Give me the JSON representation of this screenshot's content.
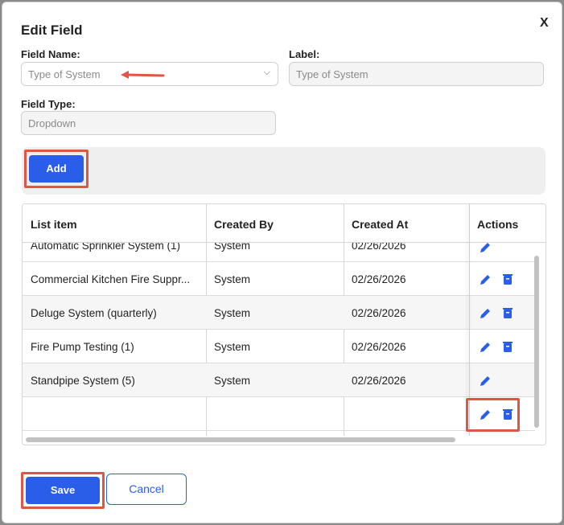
{
  "dialog": {
    "title": "Edit Field",
    "close_label": "X"
  },
  "form": {
    "field_name_label": "Field Name:",
    "field_name_value": "Type of System",
    "label_label": "Label:",
    "label_value": "Type of System",
    "field_type_label": "Field Type:",
    "field_type_value": "Dropdown"
  },
  "add_button_label": "Add",
  "table": {
    "headers": [
      "List item",
      "Created By",
      "Created At",
      "Actions"
    ],
    "rows": [
      {
        "item": "Automatic Sprinkler System (1)",
        "created_by": "System",
        "created_at": "02/26/2026",
        "actions": [
          "edit"
        ]
      },
      {
        "item": "Commercial Kitchen Fire Suppr...",
        "created_by": "System",
        "created_at": "02/26/2026",
        "actions": [
          "edit",
          "delete"
        ]
      },
      {
        "item": "Deluge System (quarterly)",
        "created_by": "System",
        "created_at": "02/26/2026",
        "actions": [
          "edit",
          "delete"
        ]
      },
      {
        "item": "Fire Pump Testing (1)",
        "created_by": "System",
        "created_at": "02/26/2026",
        "actions": [
          "edit",
          "delete"
        ]
      },
      {
        "item": "Standpipe System (5)",
        "created_by": "System",
        "created_at": "02/26/2026",
        "actions": [
          "edit"
        ]
      },
      {
        "item": "",
        "created_by": "",
        "created_at": "",
        "actions": [
          "edit",
          "delete"
        ]
      }
    ]
  },
  "footer": {
    "save_label": "Save",
    "cancel_label": "Cancel"
  },
  "icons": {
    "close": "close-icon",
    "dropdown": "chevron-down-icon",
    "edit": "pencil-icon",
    "delete": "trash-icon"
  },
  "colors": {
    "primary": "#2a5ee8",
    "annotation": "#e05545",
    "action_icon": "#2a5ee8"
  }
}
